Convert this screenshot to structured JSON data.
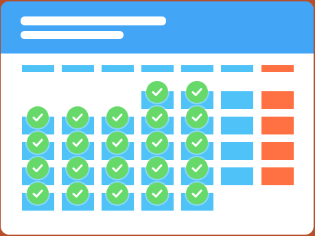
{
  "colors": {
    "page_bg": "#b94f2a",
    "header": "#42a5f5",
    "cell_blue": "#4fc3f7",
    "cell_orange": "#ff7043",
    "check": "#66d96a"
  },
  "header": {
    "lines": 2
  },
  "grid": {
    "columns": [
      {
        "color": "blue",
        "slots": [
          0,
          0,
          1,
          1,
          1,
          1
        ],
        "checked": [
          0,
          0,
          1,
          1,
          1,
          1
        ]
      },
      {
        "color": "blue",
        "slots": [
          0,
          0,
          1,
          1,
          1,
          1
        ],
        "checked": [
          0,
          0,
          1,
          1,
          1,
          1
        ]
      },
      {
        "color": "blue",
        "slots": [
          0,
          0,
          1,
          1,
          1,
          1
        ],
        "checked": [
          0,
          0,
          1,
          1,
          1,
          1
        ]
      },
      {
        "color": "blue",
        "slots": [
          0,
          1,
          1,
          1,
          1,
          1
        ],
        "checked": [
          0,
          1,
          1,
          1,
          1,
          1
        ]
      },
      {
        "color": "blue",
        "slots": [
          0,
          1,
          1,
          1,
          1,
          1
        ],
        "checked": [
          0,
          1,
          1,
          1,
          1,
          1
        ]
      },
      {
        "color": "blue",
        "slots": [
          0,
          1,
          1,
          1,
          1,
          0
        ],
        "checked": [
          0,
          0,
          0,
          0,
          0,
          0
        ]
      },
      {
        "color": "orange",
        "slots": [
          0,
          1,
          1,
          1,
          1,
          0
        ],
        "checked": [
          0,
          0,
          0,
          0,
          0,
          0
        ]
      }
    ],
    "icon": "check-icon"
  }
}
